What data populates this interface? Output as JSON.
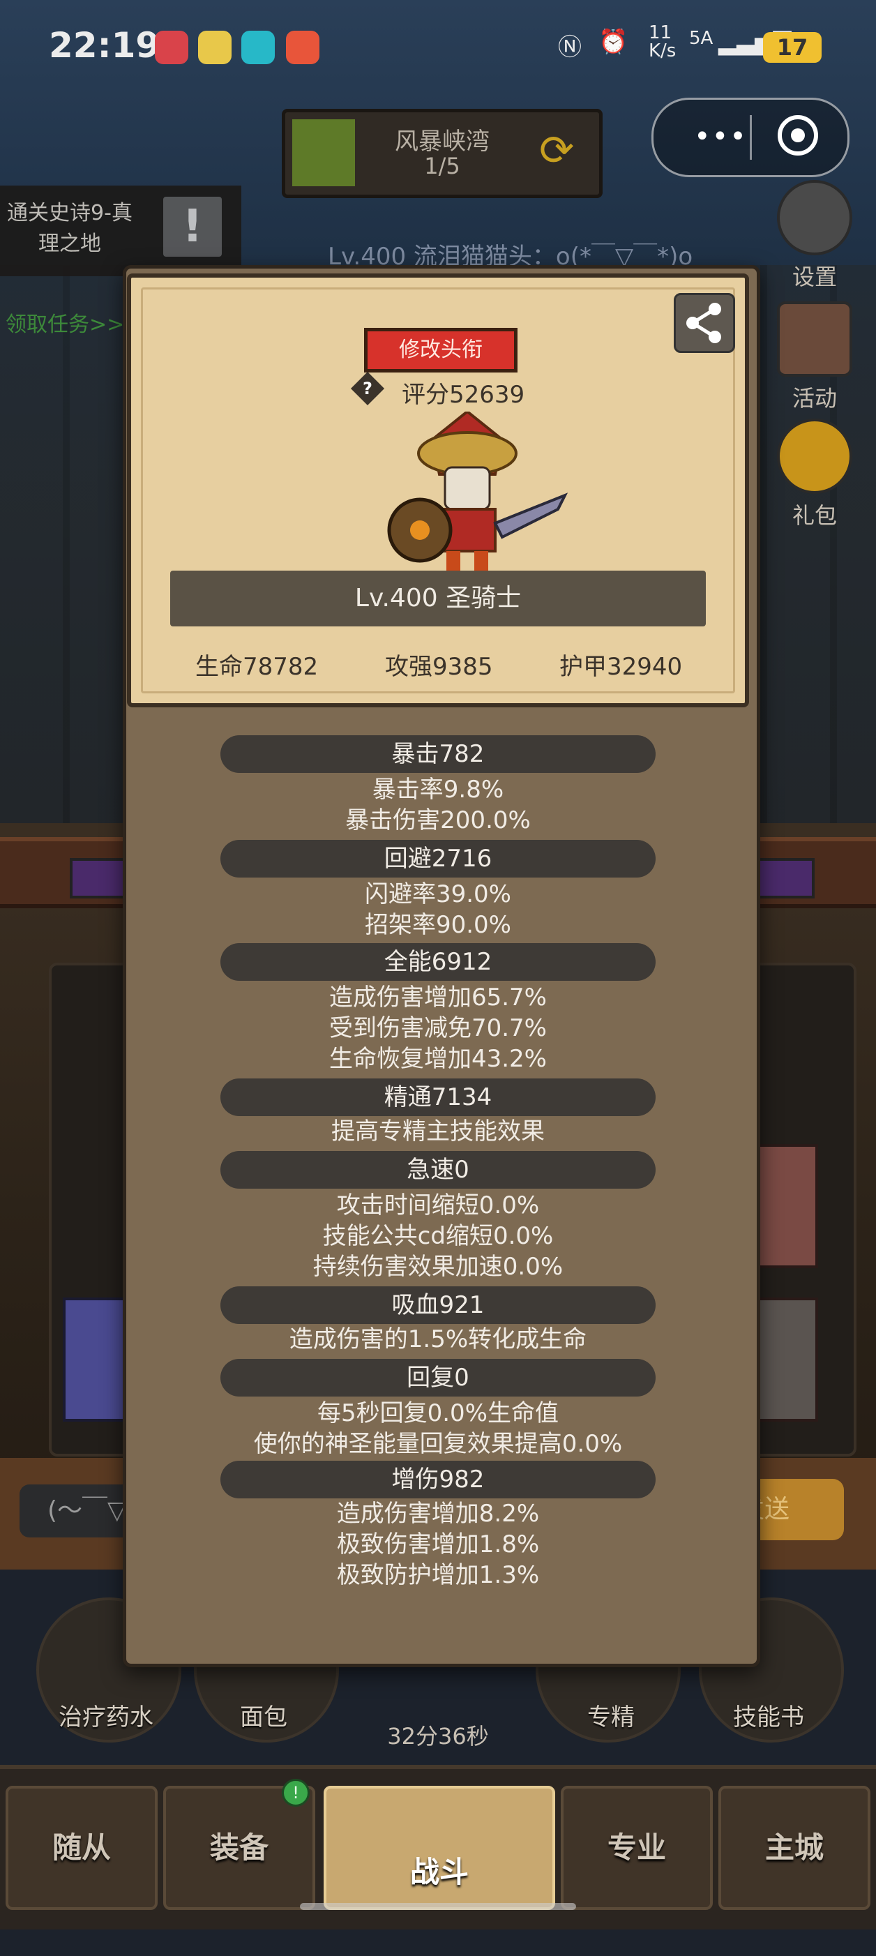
{
  "status_bar": {
    "time": "22:19",
    "net_speed_top": "11",
    "net_speed_bottom": "K/s",
    "signal": "5A",
    "battery": "17"
  },
  "map": {
    "name": "风暴峡湾",
    "progress": "1/5"
  },
  "quest": {
    "title": "通关史诗9-真理之地",
    "link": "领取任务>>"
  },
  "player_line": "Lv.400 流泪猫猫头：o(*￣▽￣*)o",
  "side_buttons": [
    {
      "label": "设置",
      "icon": "gear-icon"
    },
    {
      "label": "活动",
      "icon": "calendar-icon"
    },
    {
      "label": "礼包",
      "icon": "giftbag-icon"
    }
  ],
  "card": {
    "title_button": "修改头衔",
    "score": "评分52639",
    "class_banner": "Lv.400 圣骑士",
    "stats": {
      "hp": "生命78782",
      "atk": "攻强9385",
      "armor": "护甲32940"
    }
  },
  "sections": [
    {
      "title": "暴击782",
      "lines": [
        "暴击率9.8%",
        "暴击伤害200.0%"
      ]
    },
    {
      "title": "回避2716",
      "lines": [
        "闪避率39.0%",
        "招架率90.0%"
      ]
    },
    {
      "title": "全能6912",
      "lines": [
        "造成伤害增加65.7%",
        "受到伤害减免70.7%",
        "生命恢复增加43.2%"
      ]
    },
    {
      "title": "精通7134",
      "lines": [
        "提高专精主技能效果"
      ]
    },
    {
      "title": "急速0",
      "lines": [
        "攻击时间缩短0.0%",
        "技能公共cd缩短0.0%",
        "持续伤害效果加速0.0%"
      ]
    },
    {
      "title": "吸血921",
      "lines": [
        "造成伤害的1.5%转化成生命"
      ]
    },
    {
      "title": "回复0",
      "lines": [
        "每5秒回复0.0%生命值",
        "使你的神圣能量回复效果提高0.0%"
      ]
    },
    {
      "title": "增伤982",
      "lines": [
        "造成伤害增加8.2%",
        "极致伤害增加1.8%",
        "极致防护增加1.3%"
      ]
    }
  ],
  "chat": {
    "input_text": "(～￣▽",
    "send_label": "发送"
  },
  "shortcuts": [
    "治疗药水",
    "面包",
    "专精",
    "技能书"
  ],
  "timer": "32分36秒",
  "nav": {
    "tabs": [
      "随从",
      "装备",
      "战斗",
      "专业",
      "主城"
    ],
    "active": "战斗"
  }
}
